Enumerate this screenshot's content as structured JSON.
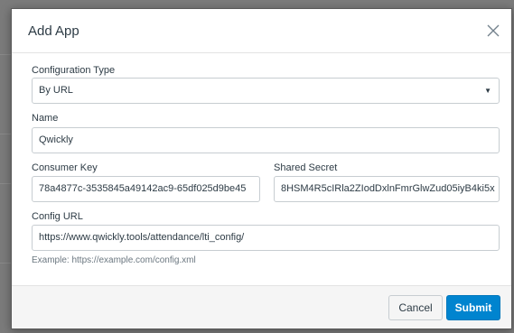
{
  "dialog": {
    "title": "Add App"
  },
  "form": {
    "config_type": {
      "label": "Configuration Type",
      "value": "By URL"
    },
    "name": {
      "label": "Name",
      "value": "Qwickly"
    },
    "consumer_key": {
      "label": "Consumer Key",
      "value": "78a4877c-3535845a49142ac9-65df025d9be45"
    },
    "shared_secret": {
      "label": "Shared Secret",
      "value": "8HSM4R5cIRla2ZIodDxlnFmrGlwZud05iyB4ki5x"
    },
    "config_url": {
      "label": "Config URL",
      "value": "https://www.qwickly.tools/attendance/lti_config/",
      "hint": "Example: https://example.com/config.xml"
    }
  },
  "footer": {
    "cancel_label": "Cancel",
    "submit_label": "Submit"
  },
  "colors": {
    "accent": "#0084cf",
    "overlay": "#7b7b7b"
  }
}
